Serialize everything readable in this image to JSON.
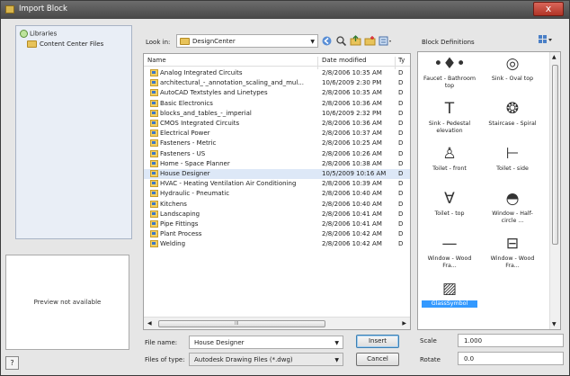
{
  "window": {
    "title": "Import Block",
    "close_glyph": "x"
  },
  "libraries": {
    "root_label": "Libraries",
    "child_label": "Content Center Files"
  },
  "preview": {
    "text": "Preview not available"
  },
  "help": {
    "glyph": "?"
  },
  "lookin": {
    "label": "Look in:",
    "value": "DesignCenter"
  },
  "toolbar_icons": [
    "back-icon",
    "search-icon",
    "folder-up-icon",
    "new-folder-icon",
    "views-icon"
  ],
  "file_list": {
    "columns": {
      "name": "Name",
      "date": "Date modified",
      "type": "Ty"
    },
    "rows": [
      {
        "name": "Analog Integrated Circuits",
        "date": "2/8/2006 10:35 AM",
        "type": "D"
      },
      {
        "name": "architectural_-_annotation_scaling_and_mul...",
        "date": "10/6/2009 2:30 PM",
        "type": "D"
      },
      {
        "name": "AutoCAD Textstyles and Linetypes",
        "date": "2/8/2006 10:35 AM",
        "type": "D"
      },
      {
        "name": "Basic Electronics",
        "date": "2/8/2006 10:36 AM",
        "type": "D"
      },
      {
        "name": "blocks_and_tables_-_imperial",
        "date": "10/6/2009 2:32 PM",
        "type": "D"
      },
      {
        "name": "CMOS Integrated Circuits",
        "date": "2/8/2006 10:36 AM",
        "type": "D"
      },
      {
        "name": "Electrical Power",
        "date": "2/8/2006 10:37 AM",
        "type": "D"
      },
      {
        "name": "Fasteners - Metric",
        "date": "2/8/2006 10:25 AM",
        "type": "D"
      },
      {
        "name": "Fasteners - US",
        "date": "2/8/2006 10:26 AM",
        "type": "D"
      },
      {
        "name": "Home - Space Planner",
        "date": "2/8/2006 10:38 AM",
        "type": "D"
      },
      {
        "name": "House Designer",
        "date": "10/5/2009 10:16 AM",
        "type": "D"
      },
      {
        "name": "HVAC - Heating Ventilation Air Conditioning",
        "date": "2/8/2006 10:39 AM",
        "type": "D"
      },
      {
        "name": "Hydraulic - Pneumatic",
        "date": "2/8/2006 10:40 AM",
        "type": "D"
      },
      {
        "name": "Kitchens",
        "date": "2/8/2006 10:40 AM",
        "type": "D"
      },
      {
        "name": "Landscaping",
        "date": "2/8/2006 10:41 AM",
        "type": "D"
      },
      {
        "name": "Pipe Fittings",
        "date": "2/8/2006 10:41 AM",
        "type": "D"
      },
      {
        "name": "Plant Process",
        "date": "2/8/2006 10:42 AM",
        "type": "D"
      },
      {
        "name": "Welding",
        "date": "2/8/2006 10:42 AM",
        "type": "D"
      }
    ],
    "scroll_left": "◀",
    "scroll_right": "▶",
    "scroll_grip": "III"
  },
  "filename": {
    "label": "File name:",
    "value": "House Designer"
  },
  "filetype": {
    "label": "Files of type:",
    "value": "Autodesk Drawing Files (*.dwg)"
  },
  "buttons": {
    "insert": "Insert",
    "cancel": "Cancel"
  },
  "block_defs": {
    "title": "Block Definitions",
    "tiles": [
      {
        "label": "Faucet - Bathroom top",
        "glyph": "•♦•",
        "icon": "faucet-icon"
      },
      {
        "label": "Sink - Oval top",
        "glyph": "◎",
        "icon": "sink-oval-icon"
      },
      {
        "label": "Sink - Pedestal elevation",
        "glyph": "T",
        "icon": "sink-pedestal-icon"
      },
      {
        "label": "Staircase - Spiral",
        "glyph": "❂",
        "icon": "staircase-spiral-icon"
      },
      {
        "label": "Toilet - front",
        "glyph": "♙",
        "icon": "toilet-front-icon"
      },
      {
        "label": "Toilet - side",
        "glyph": "⊢",
        "icon": "toilet-side-icon"
      },
      {
        "label": "Toilet - top",
        "glyph": "∀",
        "icon": "toilet-top-icon"
      },
      {
        "label": "Window - Half-circle ...",
        "glyph": "◓",
        "icon": "window-halfcircle-icon"
      },
      {
        "label": "Window - Wood Fra...",
        "glyph": "—",
        "icon": "window-wood-icon"
      },
      {
        "label": "Window - Wood Fra...",
        "glyph": "⊟",
        "icon": "window-wood-frame-icon"
      },
      {
        "label": "GlassSymbol",
        "glyph": "▨",
        "icon": "glass-symbol-icon"
      }
    ],
    "scroll_up": "▲",
    "scroll_down": "▼"
  },
  "scale": {
    "label": "Scale",
    "value": "1.000"
  },
  "rotate": {
    "label": "Rotate",
    "value": "0.0"
  },
  "colors": {
    "accent": "#3399ff",
    "title_bar": "#4d4d4d",
    "close": "#c7473a"
  }
}
